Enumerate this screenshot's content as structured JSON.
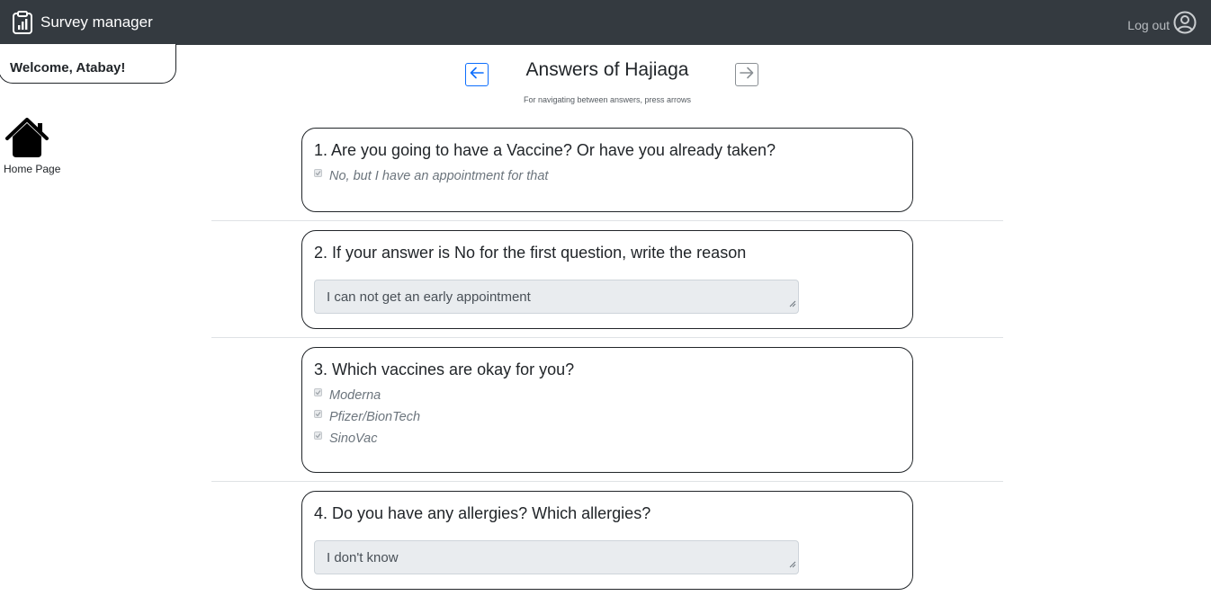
{
  "navbar": {
    "brand_icon": "clipboard-chart-icon",
    "brand_label": "Survey manager",
    "logout_label": "Log out",
    "logout_icon": "user-circle-icon",
    "background": "#343a40"
  },
  "sidebar": {
    "welcome": "Welcome, Atabay!",
    "home_icon": "house-icon",
    "home_label": "Home Page"
  },
  "header": {
    "title": "Answers of Hajiaga",
    "hint": "For navigating between answers, press arrows",
    "prev_icon": "arrow-left-icon",
    "next_icon": "arrow-right-icon",
    "accent": "#0d6efd"
  },
  "questions": [
    {
      "title": "1. Are you going to have a Vaccine? Or have you already taken?",
      "type": "checkbox",
      "options": [
        "No, but I have an appointment for that"
      ]
    },
    {
      "title": "2. If your answer is No for the first question, write the reason",
      "type": "text",
      "answer": "I can not get an early appointment"
    },
    {
      "title": "3. Which vaccines are okay for you?",
      "type": "checkbox",
      "options": [
        "Moderna",
        "Pfizer/BionTech",
        "SinoVac"
      ]
    },
    {
      "title": "4. Do you have any allergies? Which allergies?",
      "type": "text",
      "answer": "I don't know"
    }
  ]
}
